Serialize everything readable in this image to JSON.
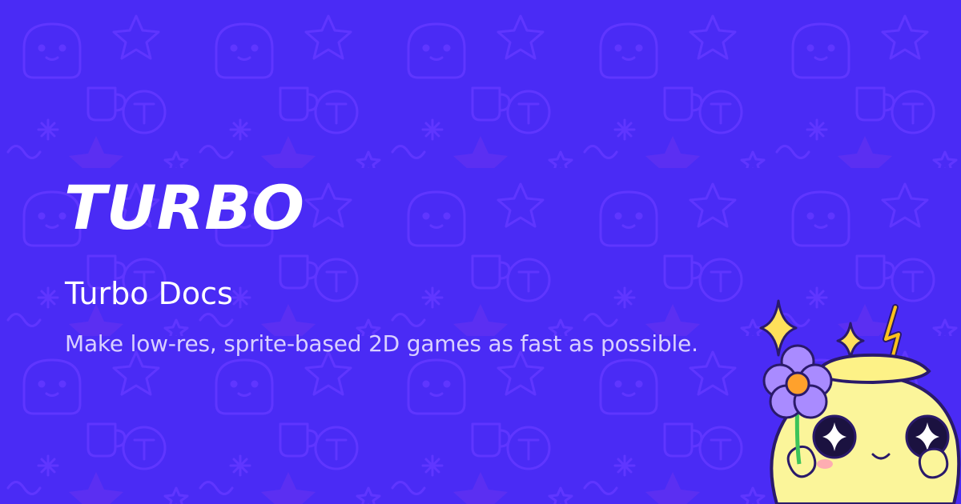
{
  "brand": {
    "logo_text": "TURBO",
    "bg_color": "#4a2bf5",
    "pattern_color": "#5e32f5",
    "pattern_accent": "#7a3cf2",
    "logo_color": "#ffffff"
  },
  "page": {
    "title": "Turbo Docs",
    "subtitle": "Make low-res, sprite-based 2D games as fast as possible."
  },
  "illustration": {
    "icon": "mascot-with-flower-icon",
    "body_color": "#fbf59a",
    "flower_color": "#a98bff",
    "sparkle_color": "#ffe05a"
  }
}
